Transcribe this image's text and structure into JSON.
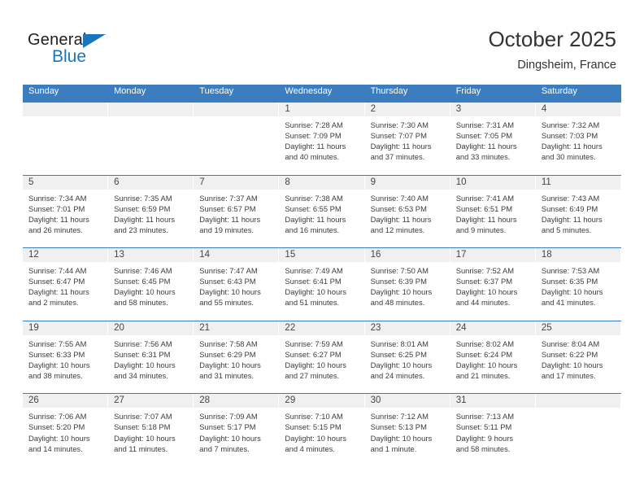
{
  "brand": {
    "name_top": "General",
    "name_bottom": "Blue",
    "triangle_color": "#1b75bb",
    "icon": "triangle-logo-icon"
  },
  "header": {
    "title": "October 2025",
    "subtitle": "Dingsheim, France",
    "accent_color": "#3b7dbf",
    "daynum_band_color": "#f0f0f0"
  },
  "weekday_headers": [
    "Sunday",
    "Monday",
    "Tuesday",
    "Wednesday",
    "Thursday",
    "Friday",
    "Saturday"
  ],
  "labels": {
    "sunrise": "Sunrise:",
    "sunset": "Sunset:",
    "daylight": "Daylight:"
  },
  "weeks": [
    [
      {
        "day": "",
        "empty": true
      },
      {
        "day": "",
        "empty": true
      },
      {
        "day": "",
        "empty": true
      },
      {
        "day": "1",
        "sunrise": "Sunrise: 7:28 AM",
        "sunset": "Sunset: 7:09 PM",
        "daylight_1": "Daylight: 11 hours",
        "daylight_2": "and 40 minutes."
      },
      {
        "day": "2",
        "sunrise": "Sunrise: 7:30 AM",
        "sunset": "Sunset: 7:07 PM",
        "daylight_1": "Daylight: 11 hours",
        "daylight_2": "and 37 minutes."
      },
      {
        "day": "3",
        "sunrise": "Sunrise: 7:31 AM",
        "sunset": "Sunset: 7:05 PM",
        "daylight_1": "Daylight: 11 hours",
        "daylight_2": "and 33 minutes."
      },
      {
        "day": "4",
        "sunrise": "Sunrise: 7:32 AM",
        "sunset": "Sunset: 7:03 PM",
        "daylight_1": "Daylight: 11 hours",
        "daylight_2": "and 30 minutes."
      }
    ],
    [
      {
        "day": "5",
        "sunrise": "Sunrise: 7:34 AM",
        "sunset": "Sunset: 7:01 PM",
        "daylight_1": "Daylight: 11 hours",
        "daylight_2": "and 26 minutes."
      },
      {
        "day": "6",
        "sunrise": "Sunrise: 7:35 AM",
        "sunset": "Sunset: 6:59 PM",
        "daylight_1": "Daylight: 11 hours",
        "daylight_2": "and 23 minutes."
      },
      {
        "day": "7",
        "sunrise": "Sunrise: 7:37 AM",
        "sunset": "Sunset: 6:57 PM",
        "daylight_1": "Daylight: 11 hours",
        "daylight_2": "and 19 minutes."
      },
      {
        "day": "8",
        "sunrise": "Sunrise: 7:38 AM",
        "sunset": "Sunset: 6:55 PM",
        "daylight_1": "Daylight: 11 hours",
        "daylight_2": "and 16 minutes."
      },
      {
        "day": "9",
        "sunrise": "Sunrise: 7:40 AM",
        "sunset": "Sunset: 6:53 PM",
        "daylight_1": "Daylight: 11 hours",
        "daylight_2": "and 12 minutes."
      },
      {
        "day": "10",
        "sunrise": "Sunrise: 7:41 AM",
        "sunset": "Sunset: 6:51 PM",
        "daylight_1": "Daylight: 11 hours",
        "daylight_2": "and 9 minutes."
      },
      {
        "day": "11",
        "sunrise": "Sunrise: 7:43 AM",
        "sunset": "Sunset: 6:49 PM",
        "daylight_1": "Daylight: 11 hours",
        "daylight_2": "and 5 minutes."
      }
    ],
    [
      {
        "day": "12",
        "sunrise": "Sunrise: 7:44 AM",
        "sunset": "Sunset: 6:47 PM",
        "daylight_1": "Daylight: 11 hours",
        "daylight_2": "and 2 minutes."
      },
      {
        "day": "13",
        "sunrise": "Sunrise: 7:46 AM",
        "sunset": "Sunset: 6:45 PM",
        "daylight_1": "Daylight: 10 hours",
        "daylight_2": "and 58 minutes."
      },
      {
        "day": "14",
        "sunrise": "Sunrise: 7:47 AM",
        "sunset": "Sunset: 6:43 PM",
        "daylight_1": "Daylight: 10 hours",
        "daylight_2": "and 55 minutes."
      },
      {
        "day": "15",
        "sunrise": "Sunrise: 7:49 AM",
        "sunset": "Sunset: 6:41 PM",
        "daylight_1": "Daylight: 10 hours",
        "daylight_2": "and 51 minutes."
      },
      {
        "day": "16",
        "sunrise": "Sunrise: 7:50 AM",
        "sunset": "Sunset: 6:39 PM",
        "daylight_1": "Daylight: 10 hours",
        "daylight_2": "and 48 minutes."
      },
      {
        "day": "17",
        "sunrise": "Sunrise: 7:52 AM",
        "sunset": "Sunset: 6:37 PM",
        "daylight_1": "Daylight: 10 hours",
        "daylight_2": "and 44 minutes."
      },
      {
        "day": "18",
        "sunrise": "Sunrise: 7:53 AM",
        "sunset": "Sunset: 6:35 PM",
        "daylight_1": "Daylight: 10 hours",
        "daylight_2": "and 41 minutes."
      }
    ],
    [
      {
        "day": "19",
        "sunrise": "Sunrise: 7:55 AM",
        "sunset": "Sunset: 6:33 PM",
        "daylight_1": "Daylight: 10 hours",
        "daylight_2": "and 38 minutes."
      },
      {
        "day": "20",
        "sunrise": "Sunrise: 7:56 AM",
        "sunset": "Sunset: 6:31 PM",
        "daylight_1": "Daylight: 10 hours",
        "daylight_2": "and 34 minutes."
      },
      {
        "day": "21",
        "sunrise": "Sunrise: 7:58 AM",
        "sunset": "Sunset: 6:29 PM",
        "daylight_1": "Daylight: 10 hours",
        "daylight_2": "and 31 minutes."
      },
      {
        "day": "22",
        "sunrise": "Sunrise: 7:59 AM",
        "sunset": "Sunset: 6:27 PM",
        "daylight_1": "Daylight: 10 hours",
        "daylight_2": "and 27 minutes."
      },
      {
        "day": "23",
        "sunrise": "Sunrise: 8:01 AM",
        "sunset": "Sunset: 6:25 PM",
        "daylight_1": "Daylight: 10 hours",
        "daylight_2": "and 24 minutes."
      },
      {
        "day": "24",
        "sunrise": "Sunrise: 8:02 AM",
        "sunset": "Sunset: 6:24 PM",
        "daylight_1": "Daylight: 10 hours",
        "daylight_2": "and 21 minutes."
      },
      {
        "day": "25",
        "sunrise": "Sunrise: 8:04 AM",
        "sunset": "Sunset: 6:22 PM",
        "daylight_1": "Daylight: 10 hours",
        "daylight_2": "and 17 minutes."
      }
    ],
    [
      {
        "day": "26",
        "sunrise": "Sunrise: 7:06 AM",
        "sunset": "Sunset: 5:20 PM",
        "daylight_1": "Daylight: 10 hours",
        "daylight_2": "and 14 minutes."
      },
      {
        "day": "27",
        "sunrise": "Sunrise: 7:07 AM",
        "sunset": "Sunset: 5:18 PM",
        "daylight_1": "Daylight: 10 hours",
        "daylight_2": "and 11 minutes."
      },
      {
        "day": "28",
        "sunrise": "Sunrise: 7:09 AM",
        "sunset": "Sunset: 5:17 PM",
        "daylight_1": "Daylight: 10 hours",
        "daylight_2": "and 7 minutes."
      },
      {
        "day": "29",
        "sunrise": "Sunrise: 7:10 AM",
        "sunset": "Sunset: 5:15 PM",
        "daylight_1": "Daylight: 10 hours",
        "daylight_2": "and 4 minutes."
      },
      {
        "day": "30",
        "sunrise": "Sunrise: 7:12 AM",
        "sunset": "Sunset: 5:13 PM",
        "daylight_1": "Daylight: 10 hours",
        "daylight_2": "and 1 minute."
      },
      {
        "day": "31",
        "sunrise": "Sunrise: 7:13 AM",
        "sunset": "Sunset: 5:11 PM",
        "daylight_1": "Daylight: 9 hours",
        "daylight_2": "and 58 minutes."
      },
      {
        "day": "",
        "empty": true
      }
    ]
  ]
}
